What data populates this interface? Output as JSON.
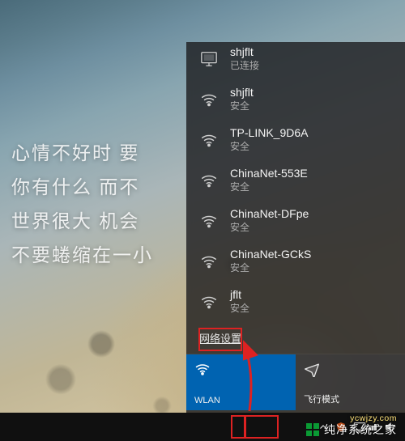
{
  "wallpaper_text": [
    "心情不好时  要",
    "你有什么  而不",
    "世界很大  机会",
    "不要蜷缩在一小"
  ],
  "flyout": {
    "connected": {
      "name": "shjflt",
      "status": "已连接",
      "icon": "ethernet-icon"
    },
    "networks": [
      {
        "name": "shjflt",
        "status": "安全",
        "icon": "wifi-icon"
      },
      {
        "name": "TP-LINK_9D6A",
        "status": "安全",
        "icon": "wifi-icon"
      },
      {
        "name": "ChinaNet-553E",
        "status": "安全",
        "icon": "wifi-icon"
      },
      {
        "name": "ChinaNet-DFpe",
        "status": "安全",
        "icon": "wifi-icon"
      },
      {
        "name": "ChinaNet-GCkS",
        "status": "安全",
        "icon": "wifi-icon"
      },
      {
        "name": "jflt",
        "status": "安全",
        "icon": "wifi-icon"
      }
    ],
    "settings_link": "网络设置",
    "tiles": {
      "wlan": {
        "label": "WLAN",
        "icon": "wifi-icon",
        "active": true
      },
      "airplane": {
        "label": "飞行模式",
        "icon": "airplane-icon",
        "active": false
      }
    }
  },
  "taskbar": {
    "tray": {
      "chevron": "chevron-up-icon",
      "security": "shield-icon",
      "network": "ethernet-icon",
      "volume": "volume-icon"
    }
  },
  "watermark": {
    "url": "ycwjzy.com",
    "brand": "纯净系统之家"
  },
  "colors": {
    "accent": "#0063b1",
    "highlight_box": "#d22222"
  }
}
